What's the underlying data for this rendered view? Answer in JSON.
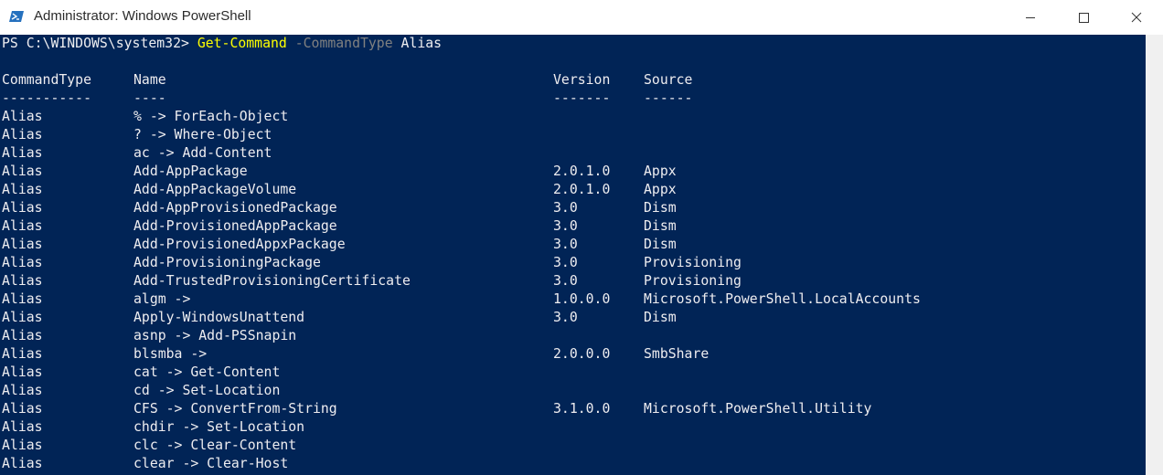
{
  "window": {
    "title": "Administrator: Windows PowerShell",
    "icon": "powershell-icon",
    "controls": [
      "minimize-icon",
      "maximize-icon",
      "close-icon"
    ]
  },
  "colors": {
    "console_bg": "#012456",
    "console_fg": "#eeedf0",
    "command": "#ffff00",
    "parameter": "#808080"
  },
  "prompt": {
    "path": "PS C:\\WINDOWS\\system32> ",
    "command": "Get-Command",
    "parameter": " -CommandType",
    "argument": " Alias"
  },
  "table": {
    "headers": [
      "CommandType",
      "Name",
      "Version",
      "Source"
    ],
    "separators": [
      "-----------",
      "----",
      "-------",
      "------"
    ],
    "rows": [
      [
        "Alias",
        "% -> ForEach-Object",
        "",
        ""
      ],
      [
        "Alias",
        "? -> Where-Object",
        "",
        ""
      ],
      [
        "Alias",
        "ac -> Add-Content",
        "",
        ""
      ],
      [
        "Alias",
        "Add-AppPackage",
        "2.0.1.0",
        "Appx"
      ],
      [
        "Alias",
        "Add-AppPackageVolume",
        "2.0.1.0",
        "Appx"
      ],
      [
        "Alias",
        "Add-AppProvisionedPackage",
        "3.0",
        "Dism"
      ],
      [
        "Alias",
        "Add-ProvisionedAppPackage",
        "3.0",
        "Dism"
      ],
      [
        "Alias",
        "Add-ProvisionedAppxPackage",
        "3.0",
        "Dism"
      ],
      [
        "Alias",
        "Add-ProvisioningPackage",
        "3.0",
        "Provisioning"
      ],
      [
        "Alias",
        "Add-TrustedProvisioningCertificate",
        "3.0",
        "Provisioning"
      ],
      [
        "Alias",
        "algm ->",
        "1.0.0.0",
        "Microsoft.PowerShell.LocalAccounts"
      ],
      [
        "Alias",
        "Apply-WindowsUnattend",
        "3.0",
        "Dism"
      ],
      [
        "Alias",
        "asnp -> Add-PSSnapin",
        "",
        ""
      ],
      [
        "Alias",
        "blsmba ->",
        "2.0.0.0",
        "SmbShare"
      ],
      [
        "Alias",
        "cat -> Get-Content",
        "",
        ""
      ],
      [
        "Alias",
        "cd -> Set-Location",
        "",
        ""
      ],
      [
        "Alias",
        "CFS -> ConvertFrom-String",
        "3.1.0.0",
        "Microsoft.PowerShell.Utility"
      ],
      [
        "Alias",
        "chdir -> Set-Location",
        "",
        ""
      ],
      [
        "Alias",
        "clc -> Clear-Content",
        "",
        ""
      ],
      [
        "Alias",
        "clear -> Clear-Host",
        "",
        ""
      ]
    ]
  }
}
